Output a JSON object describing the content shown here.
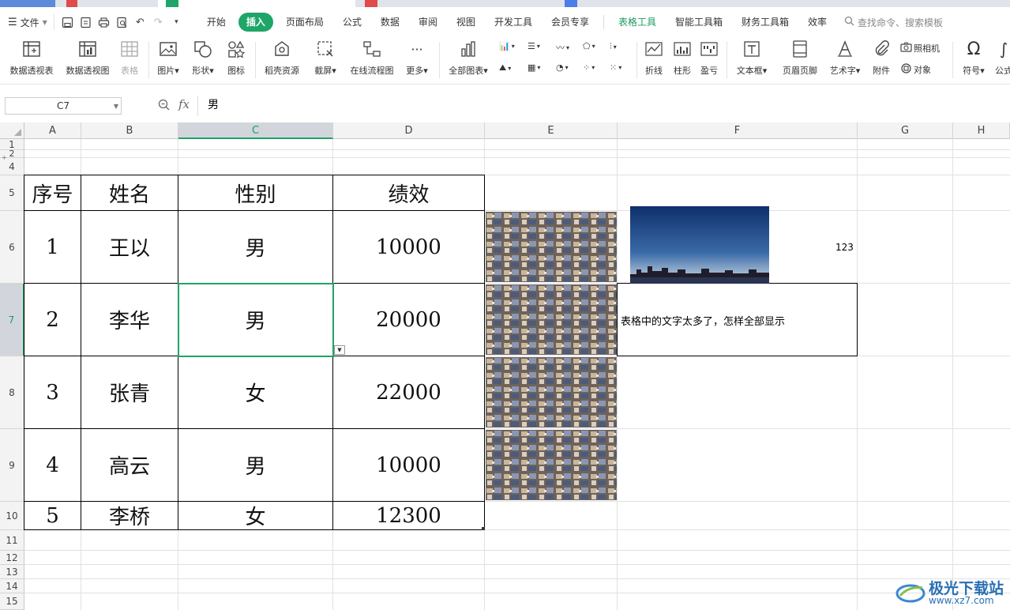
{
  "menu": {
    "file_label": "文件",
    "tabs": [
      "开始",
      "插入",
      "页面布局",
      "公式",
      "数据",
      "审阅",
      "视图",
      "开发工具",
      "会员专享"
    ],
    "active_tab": "插入",
    "context_tabs": [
      "表格工具",
      "智能工具箱",
      "财务工具箱",
      "效率"
    ],
    "search_placeholder": "查找命令、搜索模板"
  },
  "ribbon": {
    "pivot_table": "数据透视表",
    "pivot_chart": "数据透视图",
    "table": "表格",
    "picture": "图片",
    "shape": "形状",
    "icon": "图标",
    "daoke": "稻壳资源",
    "screenshot": "截屏",
    "flowchart": "在线流程图",
    "more": "更多",
    "all_charts": "全部图表",
    "line": "折线",
    "column": "柱形",
    "winloss": "盈亏",
    "textbox": "文本框",
    "header_footer": "页眉页脚",
    "wordart": "艺术字",
    "attachment": "附件",
    "camera": "照相机",
    "object": "对象",
    "symbol": "符号",
    "formula": "公式"
  },
  "formula_bar": {
    "name_box": "C7",
    "fx": "fx",
    "content": "男"
  },
  "columns": [
    "A",
    "B",
    "C",
    "D",
    "E",
    "F",
    "G",
    "H"
  ],
  "rows": [
    "1",
    "2",
    "4",
    "5",
    "6",
    "7",
    "8",
    "9",
    "10",
    "11",
    "12",
    "13",
    "14",
    "15"
  ],
  "table": {
    "headers": [
      "序号",
      "姓名",
      "性别",
      "绩效"
    ],
    "rows": [
      [
        "1",
        "王以",
        "男",
        "10000"
      ],
      [
        "2",
        "李华",
        "男",
        "20000"
      ],
      [
        "3",
        "张青",
        "女",
        "22000"
      ],
      [
        "4",
        "高云",
        "男",
        "10000"
      ],
      [
        "5",
        "李桥",
        "女",
        "12300"
      ]
    ]
  },
  "extra": {
    "f6_value": "123",
    "f7_text": "表格中的文字太多了，怎样全部显示"
  },
  "watermark": {
    "title": "极光下载站",
    "url": "www.xz7.com"
  },
  "colors": {
    "accent": "#1fa568",
    "header_bg": "#f3f3f3",
    "selected_header_bg": "#d2d6dc"
  }
}
